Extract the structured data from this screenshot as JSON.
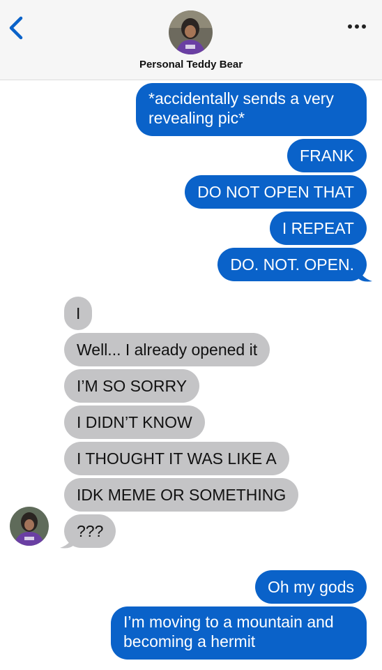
{
  "header": {
    "contact_name": "Personal Teddy Bear",
    "back_icon": "chevron-left-icon",
    "more_icon": "ellipsis-icon",
    "accent_color": "#0a62c9"
  },
  "messages": [
    {
      "direction": "sent",
      "text_lines": [
        "*accidentally sends a very",
        "revealing pic*"
      ]
    },
    {
      "direction": "sent",
      "text": "FRANK"
    },
    {
      "direction": "sent",
      "text": "DO NOT OPEN THAT"
    },
    {
      "direction": "sent",
      "text": "I REPEAT"
    },
    {
      "direction": "sent",
      "text": "DO. NOT. OPEN."
    },
    {
      "direction": "received",
      "text": "I"
    },
    {
      "direction": "received",
      "text": "Well... I already opened it"
    },
    {
      "direction": "received",
      "text": "I’M SO SORRY"
    },
    {
      "direction": "received",
      "text": "I DIDN’T KNOW"
    },
    {
      "direction": "received",
      "text": "I THOUGHT IT WAS LIKE A"
    },
    {
      "direction": "received",
      "text": "IDK MEME OR SOMETHING"
    },
    {
      "direction": "received",
      "text": "???"
    },
    {
      "direction": "sent",
      "text": "Oh my gods"
    },
    {
      "direction": "sent",
      "text_lines": [
        "I’m moving to a mountain and",
        "becoming a hermit"
      ]
    }
  ],
  "colors": {
    "sent_bubble": "#0a62c9",
    "received_bubble": "#c4c4c6",
    "header_bg": "#f6f6f6"
  }
}
